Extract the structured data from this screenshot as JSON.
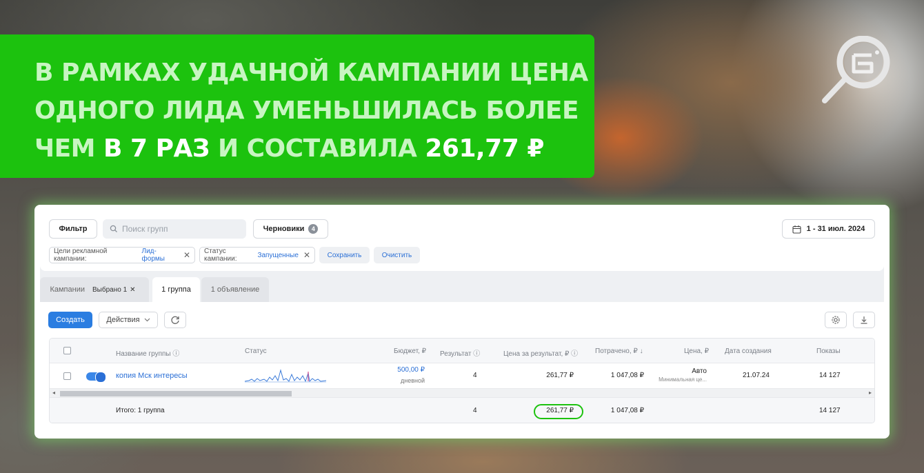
{
  "banner": {
    "line1": "В РАМКАХ УДАЧНОЙ КАМПАНИИ ЦЕНА",
    "line2": "ОДНОГО ЛИДА УМЕНЬШИЛАСЬ БОЛЕЕ",
    "line3_a": "ЧЕМ ",
    "line3_b": "В 7 РАЗ",
    "line3_c": " И СОСТАВИЛА ",
    "line3_d": "261,77 ₽"
  },
  "toolbar": {
    "filter_label": "Фильтр",
    "search_placeholder": "Поиск групп",
    "drafts_label": "Черновики",
    "drafts_count": "4",
    "date_range": "1 - 31 июл. 2024"
  },
  "chips": [
    {
      "key": "Цели рекламной кампании:",
      "value": "Лид-формы"
    },
    {
      "key": "Статус кампании:",
      "value": "Запущенные"
    }
  ],
  "chip_actions": {
    "save": "Сохранить",
    "clear": "Очистить"
  },
  "tabs": {
    "campaigns": "Кампании",
    "selected": "Выбрано 1",
    "groups": "1 группа",
    "ads": "1 объявление"
  },
  "actions": {
    "create": "Создать",
    "actions": "Действия"
  },
  "table": {
    "headers": {
      "name": "Название группы",
      "status": "Статус",
      "budget": "Бюджет, ₽",
      "result": "Результат",
      "cpr": "Цена за результат, ₽",
      "spent": "Потрачено, ₽ ↓",
      "price": "Цена, ₽",
      "created": "Дата создания",
      "shows": "Показы"
    },
    "row": {
      "name": "копия Мск интересы",
      "budget": "500,00 ₽",
      "budget_period": "дневной",
      "result": "4",
      "cpr": "261,77 ₽",
      "spent": "1 047,08 ₽",
      "price_mode": "Авто",
      "price_sub": "Минимальная це...",
      "created": "21.07.24",
      "shows": "14 127"
    },
    "total": {
      "label": "Итого: 1 группа",
      "result": "4",
      "cpr": "261,77 ₽",
      "spent": "1 047,08 ₽",
      "shows": "14 127"
    }
  },
  "colors": {
    "green": "#1cc20e",
    "accent": "#2a7de1",
    "link": "#2a6fd6"
  }
}
